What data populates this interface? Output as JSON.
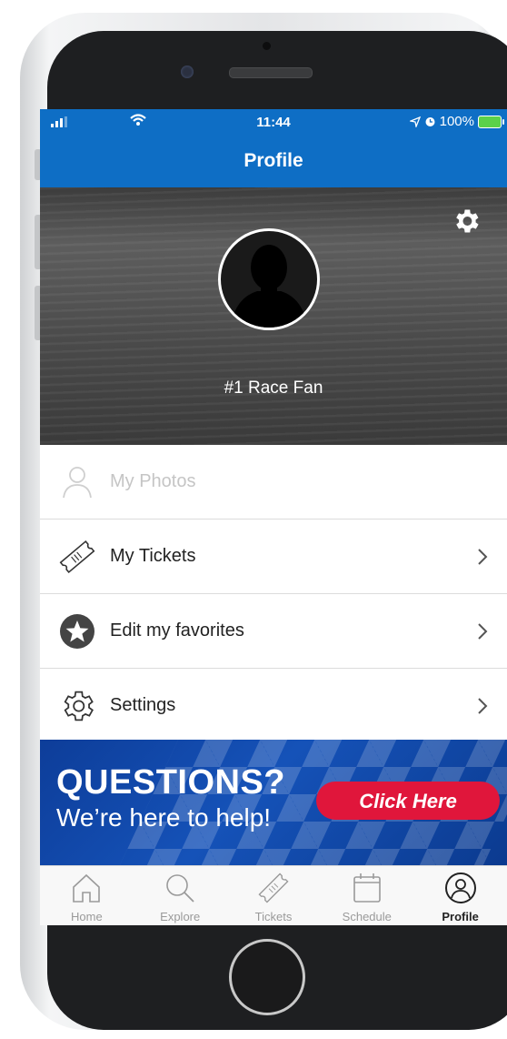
{
  "status_bar": {
    "time": "11:44",
    "battery": "100%"
  },
  "navbar": {
    "title": "Profile"
  },
  "profile": {
    "name": "#1 Race Fan"
  },
  "menu": {
    "items": [
      {
        "label": "My Photos",
        "icon": "person-icon",
        "enabled": false
      },
      {
        "label": "My Tickets",
        "icon": "ticket-icon",
        "enabled": true
      },
      {
        "label": "Edit my favorites",
        "icon": "star-icon",
        "enabled": true
      },
      {
        "label": "Settings",
        "icon": "gear-outline-icon",
        "enabled": true
      }
    ]
  },
  "banner": {
    "headline": "QUESTIONS?",
    "subline": "We’re here to help!",
    "button_label": "Click Here"
  },
  "tabbar": {
    "tabs": [
      {
        "label": "Home",
        "icon": "home-icon",
        "active": false
      },
      {
        "label": "Explore",
        "icon": "search-icon",
        "active": false
      },
      {
        "label": "Tickets",
        "icon": "ticket-icon",
        "active": false
      },
      {
        "label": "Schedule",
        "icon": "calendar-icon",
        "active": false
      },
      {
        "label": "Profile",
        "icon": "profile-icon",
        "active": true
      }
    ]
  },
  "colors": {
    "brand_blue": "#0e6ec5",
    "cta_red": "#e0163b",
    "banner_blue": "#1552b8"
  }
}
